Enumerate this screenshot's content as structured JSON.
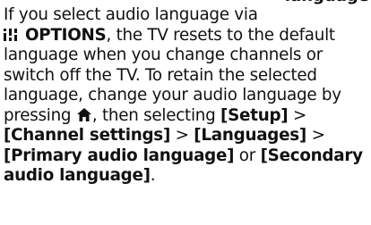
{
  "cut_heading": "language",
  "text": {
    "l1": "If you select audio language via",
    "options_label": "OPTIONS",
    "l2_rest": ", the TV resets to the default",
    "l3": "language when you change channels or",
    "l4": "switch off the TV. To retain the selected",
    "l5": "language, change your audio language by",
    "l6_a": "pressing ",
    "l6_b": ", then selecting ",
    "setup": "[Setup]",
    "sep1": " >",
    "channel_settings": "[Channel settings]",
    "sep2": " > ",
    "languages": "[Languages]",
    "sep3": " >",
    "primary": "[Primary audio language]",
    "or": " or ",
    "secondary_a": "[Secondary",
    "secondary_b": "audio language]",
    "end": "."
  },
  "icons": {
    "options": "options-icon",
    "home": "home-icon"
  }
}
